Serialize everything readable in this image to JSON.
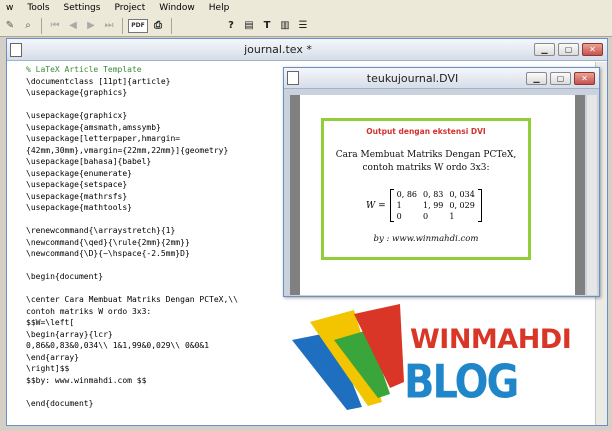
{
  "menu": [
    "w",
    "Tools",
    "Settings",
    "Project",
    "Window",
    "Help"
  ],
  "toolbar": {
    "pdf_label": "PDF"
  },
  "editor": {
    "title": "journal.tex *",
    "lines": [
      "% LaTeX Article Template",
      "\\documentclass [11pt]{article}",
      "\\usepackage{graphics}",
      "",
      "\\usepackage{graphicx}",
      "\\usepackage{amsmath,amssymb}",
      "\\usepackage[letterpaper,hmargin=",
      "{42mm,30mm},vmargin={22mm,22mm}]{geometry}",
      "\\usepackage[bahasa]{babel}",
      "\\usepackage{enumerate}",
      "\\usepackage{setspace}",
      "\\usepackage{mathrsfs}",
      "\\usepackage{mathtools}",
      "",
      "\\renewcommand{\\arraystretch}{1}",
      "\\newcommand{\\qed}{\\rule{2mm}{2mm}}",
      "\\newcommand{\\D}{~\\hspace{-2.5mm}D}",
      "",
      "\\begin{document}",
      "",
      "\\center Cara Membuat Matriks Dengan PCTeX,\\\\",
      "contoh matriks W ordo 3x3:",
      "$$W=\\left[",
      "\\begin{array}{lcr}",
      "0,86&0,83&0,034\\\\ 1&1,99&0,029\\\\ 0&0&1",
      "\\end{array}",
      "\\right]$$",
      "$$by: www.winmahdi.com $$",
      "",
      "\\end{document}"
    ]
  },
  "dvi": {
    "title": "teukujournal.DVI",
    "heading": "Output dengan ekstensi DVI",
    "line1": "Cara Membuat Matriks Dengan PCTeX,",
    "line2": "contoh matriks W ordo 3x3:",
    "lhs": "W =",
    "matrix": [
      [
        "0, 86",
        "0, 83",
        "0, 034"
      ],
      [
        "1",
        "1, 99",
        "0, 029"
      ],
      [
        "0",
        "0",
        "1"
      ]
    ],
    "by": "by : www.winmahdi.com"
  },
  "logo": {
    "name": "WINMAHDI",
    "sub": "BLOG"
  },
  "colors": {
    "logo_red": "#d93628",
    "logo_blue": "#1e86c9",
    "frame_green": "#92cd3a",
    "comment_green": "#3a8a3a"
  }
}
